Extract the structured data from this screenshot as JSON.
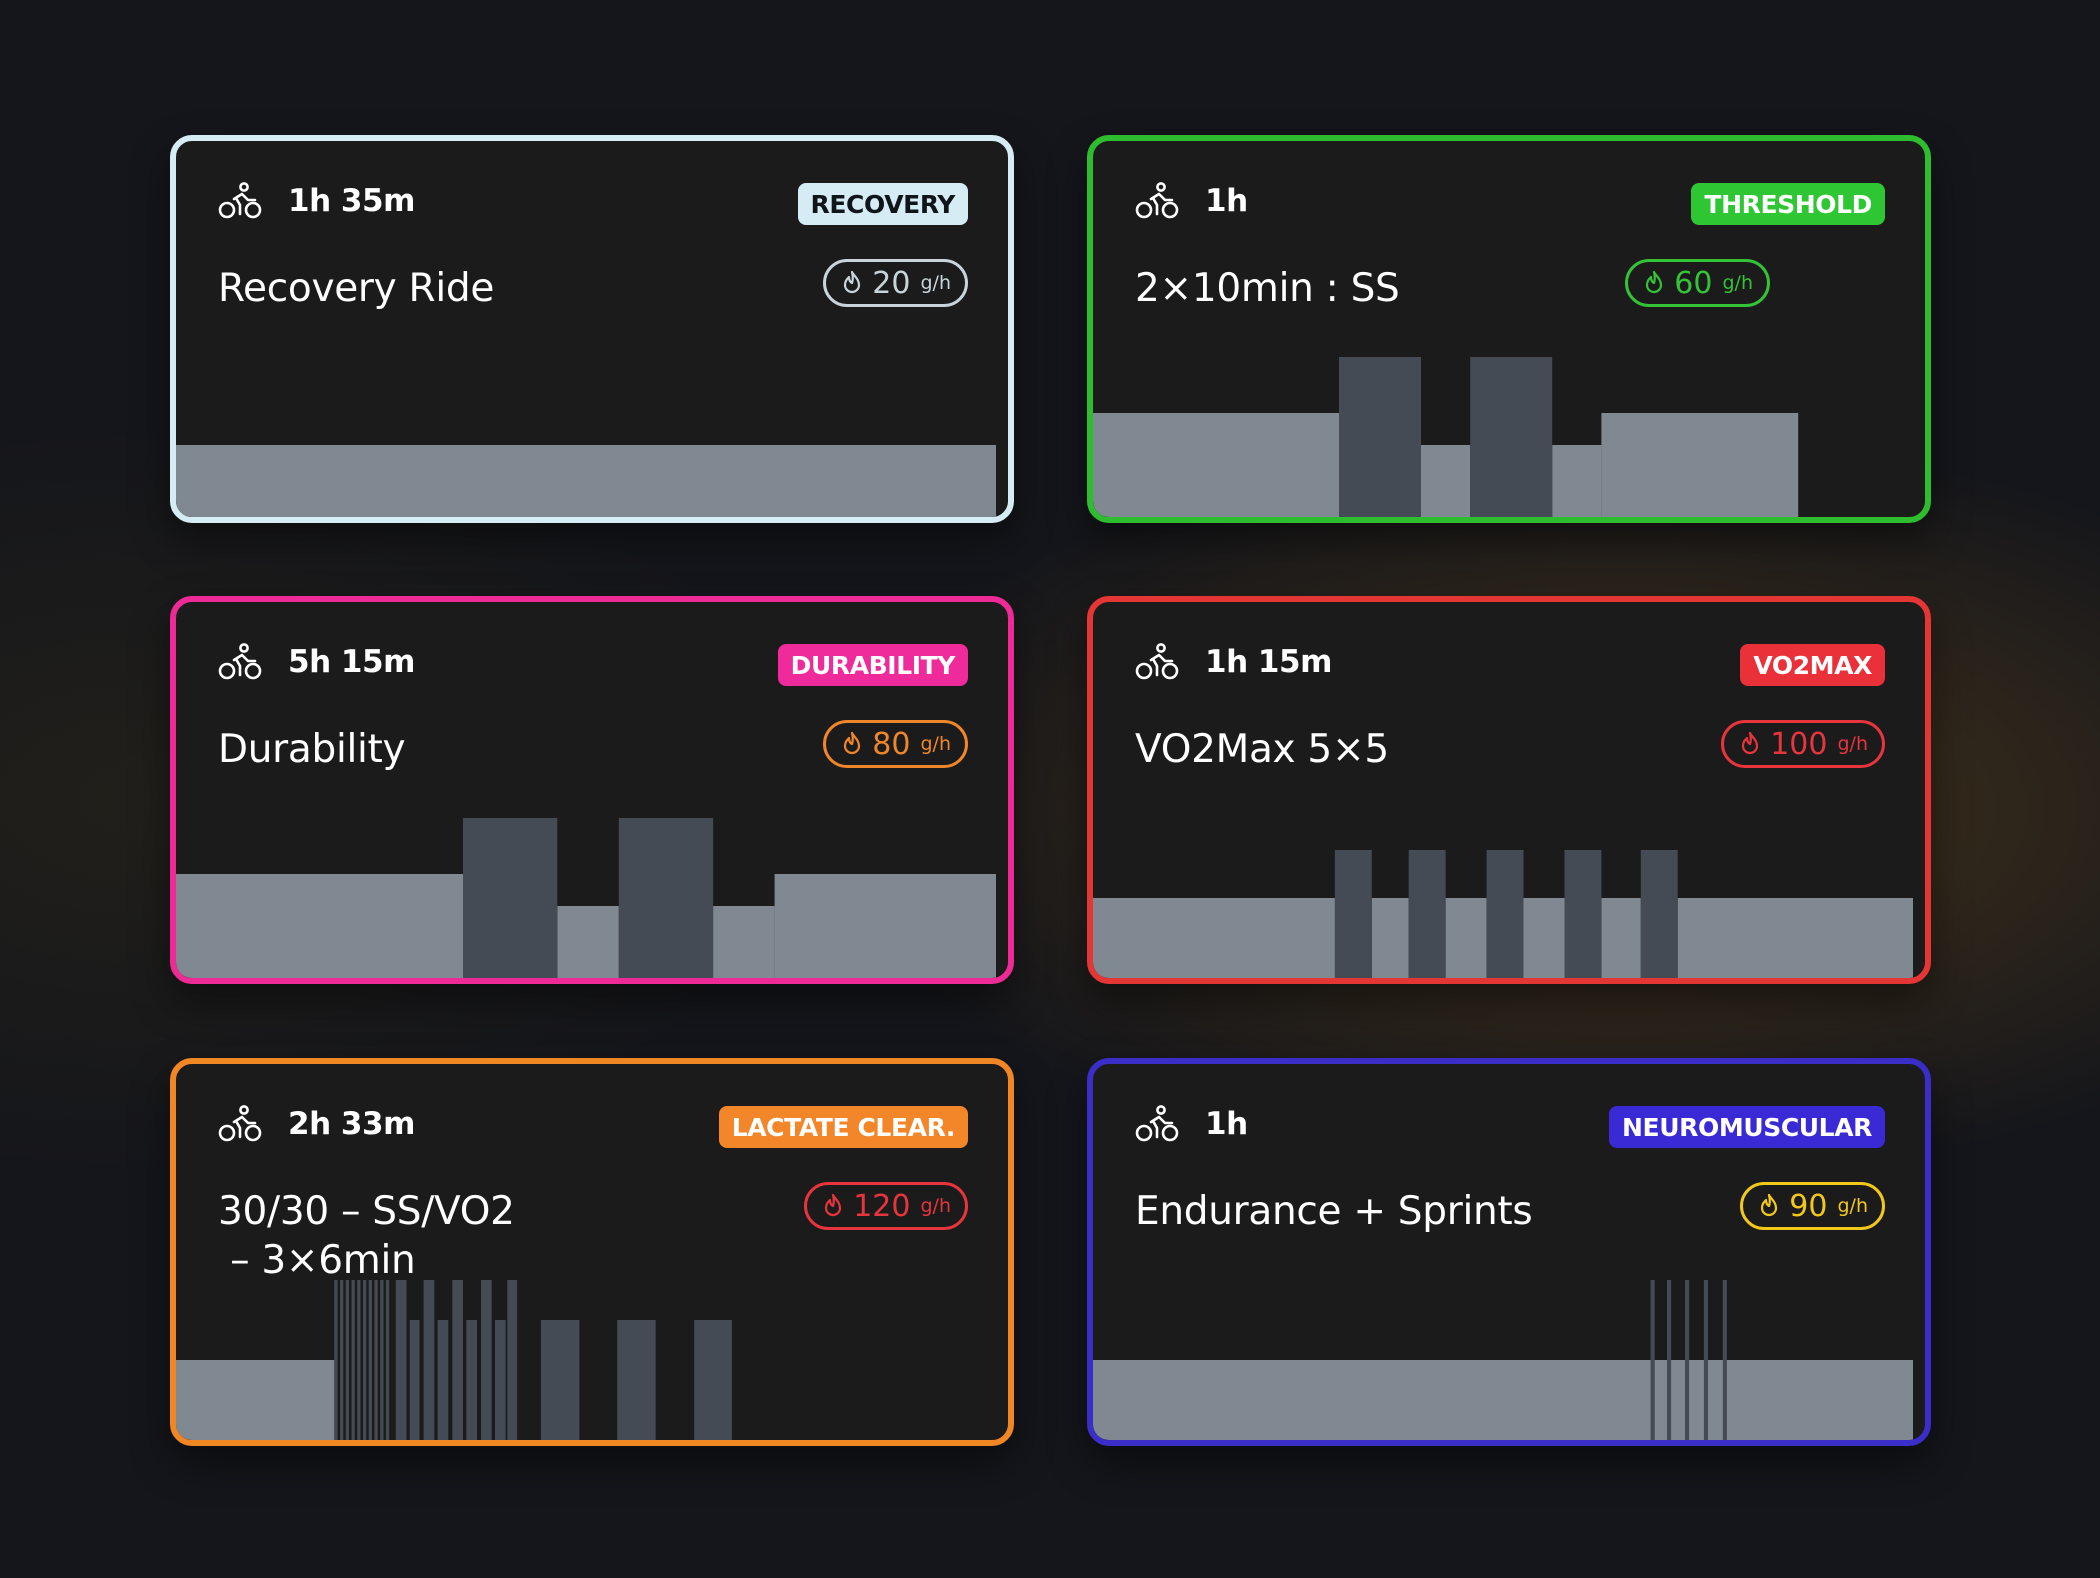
{
  "workouts": [
    {
      "duration": "1h 35m",
      "category": "RECOVERY",
      "title": "Recovery Ride",
      "carbs_value": "20",
      "carbs_unit": "g/h",
      "colors": {
        "border": "#d6ecf4",
        "badge_bg": "#d6ecf4",
        "badge_text": "#10151a",
        "carb": "#c8d4da"
      },
      "chart_data": {
        "type": "bar",
        "x_unit": "fraction of workout",
        "segments": [
          {
            "start": 0,
            "end": 1,
            "intensity": 0.45
          }
        ]
      }
    },
    {
      "duration": "1h",
      "category": "THRESHOLD",
      "title": "2×10min : SS",
      "carbs_value": "60",
      "carbs_unit": "g/h",
      "colors": {
        "border": "#2ebd2e",
        "badge_bg": "#2fc633",
        "badge_text": "#ffffff",
        "carb": "#34c236"
      },
      "chart_data": {
        "type": "bar",
        "x_unit": "fraction of workout",
        "segments": [
          {
            "start": 0,
            "end": 0.3,
            "intensity": 0.65
          },
          {
            "start": 0.3,
            "end": 0.4,
            "intensity": 1.0
          },
          {
            "start": 0.4,
            "end": 0.46,
            "intensity": 0.45
          },
          {
            "start": 0.46,
            "end": 0.56,
            "intensity": 1.0
          },
          {
            "start": 0.56,
            "end": 0.62,
            "intensity": 0.45
          },
          {
            "start": 0.62,
            "end": 0.86,
            "intensity": 0.65
          }
        ]
      }
    },
    {
      "duration": "5h 15m",
      "category": "DURABILITY",
      "title": "Durability",
      "carbs_value": "80",
      "carbs_unit": "g/h",
      "colors": {
        "border": "#ee2a96",
        "badge_bg": "#ef2a9a",
        "badge_text": "#ffffff",
        "carb": "#f0862a"
      },
      "chart_data": {
        "type": "bar",
        "x_unit": "fraction of workout",
        "segments": [
          {
            "start": 0,
            "end": 0.35,
            "intensity": 0.65
          },
          {
            "start": 0.35,
            "end": 0.465,
            "intensity": 1.0
          },
          {
            "start": 0.465,
            "end": 0.54,
            "intensity": 0.45
          },
          {
            "start": 0.54,
            "end": 0.655,
            "intensity": 1.0
          },
          {
            "start": 0.655,
            "end": 0.73,
            "intensity": 0.45
          },
          {
            "start": 0.73,
            "end": 1.0,
            "intensity": 0.65
          }
        ]
      }
    },
    {
      "duration": "1h 15m",
      "category": "VO2MAX",
      "title": "VO2Max 5×5",
      "carbs_value": "100",
      "carbs_unit": "g/h",
      "colors": {
        "border": "#e53636",
        "badge_bg": "#ea3039",
        "badge_text": "#ffffff",
        "carb": "#e8343c"
      },
      "chart_data": {
        "type": "bar",
        "x_unit": "fraction of workout",
        "segments": [
          {
            "start": 0,
            "end": 0.295,
            "intensity": 0.5
          },
          {
            "start": 0.295,
            "end": 0.34,
            "intensity": 0.8
          },
          {
            "start": 0.34,
            "end": 0.385,
            "intensity": 0.5
          },
          {
            "start": 0.385,
            "end": 0.43,
            "intensity": 0.8
          },
          {
            "start": 0.43,
            "end": 0.48,
            "intensity": 0.5
          },
          {
            "start": 0.48,
            "end": 0.525,
            "intensity": 0.8
          },
          {
            "start": 0.525,
            "end": 0.575,
            "intensity": 0.5
          },
          {
            "start": 0.575,
            "end": 0.62,
            "intensity": 0.8
          },
          {
            "start": 0.62,
            "end": 0.668,
            "intensity": 0.5
          },
          {
            "start": 0.668,
            "end": 0.713,
            "intensity": 0.8
          },
          {
            "start": 0.713,
            "end": 1.0,
            "intensity": 0.5
          }
        ]
      }
    },
    {
      "duration": "2h 33m",
      "category": "LACTATE CLEAR.",
      "title": "30/30 – SS/VO2\n – 3×6min",
      "carbs_value": "120",
      "carbs_unit": "g/h",
      "colors": {
        "border": "#f18624",
        "badge_bg": "#f4862a",
        "badge_text": "#ffffff",
        "carb": "#e8343c"
      },
      "chart_data": {
        "type": "bar",
        "x_unit": "fraction of workout",
        "segments": [
          {
            "start": 0,
            "end": 0.193,
            "intensity": 0.5
          },
          {
            "start": 0.193,
            "end": 0.197,
            "intensity": 1.0
          },
          {
            "start": 0.2,
            "end": 0.204,
            "intensity": 1.0
          },
          {
            "start": 0.207,
            "end": 0.211,
            "intensity": 1.0
          },
          {
            "start": 0.214,
            "end": 0.218,
            "intensity": 1.0
          },
          {
            "start": 0.221,
            "end": 0.225,
            "intensity": 1.0
          },
          {
            "start": 0.228,
            "end": 0.232,
            "intensity": 1.0
          },
          {
            "start": 0.235,
            "end": 0.239,
            "intensity": 1.0
          },
          {
            "start": 0.242,
            "end": 0.246,
            "intensity": 1.0
          },
          {
            "start": 0.249,
            "end": 0.253,
            "intensity": 1.0
          },
          {
            "start": 0.256,
            "end": 0.26,
            "intensity": 1.0
          },
          {
            "start": 0.268,
            "end": 0.281,
            "intensity": 1.0
          },
          {
            "start": 0.285,
            "end": 0.297,
            "intensity": 0.75
          },
          {
            "start": 0.302,
            "end": 0.315,
            "intensity": 1.0
          },
          {
            "start": 0.319,
            "end": 0.332,
            "intensity": 0.75
          },
          {
            "start": 0.337,
            "end": 0.35,
            "intensity": 1.0
          },
          {
            "start": 0.354,
            "end": 0.367,
            "intensity": 0.75
          },
          {
            "start": 0.372,
            "end": 0.385,
            "intensity": 1.0
          },
          {
            "start": 0.389,
            "end": 0.402,
            "intensity": 0.75
          },
          {
            "start": 0.404,
            "end": 0.416,
            "intensity": 1.0
          },
          {
            "start": 0.445,
            "end": 0.492,
            "intensity": 0.75
          },
          {
            "start": 0.538,
            "end": 0.585,
            "intensity": 0.75
          },
          {
            "start": 0.632,
            "end": 0.678,
            "intensity": 0.75
          }
        ]
      }
    },
    {
      "duration": "1h",
      "category": "NEUROMUSCULAR",
      "title": "Endurance + Sprints",
      "carbs_value": "90",
      "carbs_unit": "g/h",
      "colors": {
        "border": "#3a2dc8",
        "badge_bg": "#3a2ad6",
        "badge_text": "#ffffff",
        "carb": "#f2c81a"
      },
      "chart_data": {
        "type": "bar",
        "x_unit": "fraction of workout",
        "segments": [
          {
            "start": 0,
            "end": 1,
            "intensity": 0.5
          },
          {
            "start": 0.68,
            "end": 0.685,
            "intensity": 1.0
          },
          {
            "start": 0.7,
            "end": 0.705,
            "intensity": 1.0
          },
          {
            "start": 0.722,
            "end": 0.727,
            "intensity": 1.0
          },
          {
            "start": 0.745,
            "end": 0.75,
            "intensity": 1.0
          },
          {
            "start": 0.768,
            "end": 0.773,
            "intensity": 1.0
          }
        ]
      }
    }
  ]
}
